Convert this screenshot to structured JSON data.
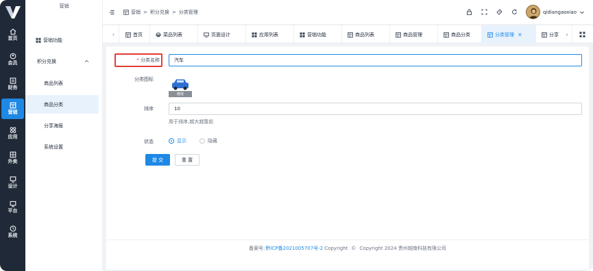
{
  "rail": {
    "items": [
      {
        "label": "首页"
      },
      {
        "label": "会员"
      },
      {
        "label": "财务"
      },
      {
        "label": "营销"
      },
      {
        "label": "应用"
      },
      {
        "label": "外卖"
      },
      {
        "label": "设计"
      },
      {
        "label": "平台"
      },
      {
        "label": "系统"
      }
    ]
  },
  "submenu": {
    "title": "营销",
    "items": [
      {
        "label": "营销功能"
      },
      {
        "label": "积分兑换"
      },
      {
        "label": "商品列表"
      },
      {
        "label": "商品分类"
      },
      {
        "label": "分享海报"
      },
      {
        "label": "系统设置"
      }
    ]
  },
  "breadcrumb": {
    "first": "营销",
    "sep1": ">",
    "second": "积分兑换",
    "sep2": ">",
    "third": "分类管理"
  },
  "user": {
    "name": "qidiangaoxiao"
  },
  "tabs": [
    {
      "label": "首页"
    },
    {
      "label": "菜品列表"
    },
    {
      "label": "页面设计"
    },
    {
      "label": "应用列表"
    },
    {
      "label": "营销功能"
    },
    {
      "label": "商品列表"
    },
    {
      "label": "商品管理"
    },
    {
      "label": "商品分类"
    },
    {
      "label": "分类管理"
    },
    {
      "label": "分享"
    }
  ],
  "tab_close": "×",
  "form": {
    "name_label_star": "*",
    "name_label": "分类名称",
    "name_value": "汽车",
    "icon_label": "分类图标",
    "icon_caption": "修改",
    "sort_label": "排序",
    "sort_value": "10",
    "sort_hint": "用于排序,越大越靠前",
    "status_label": "状态",
    "status_on": "显示",
    "status_off": "隐藏",
    "submit": "提 交",
    "reset": "重 置"
  },
  "footer": {
    "prefix": "备案号:",
    "icp": "黔ICP备2021005707号-2",
    "copy1": "Copyright",
    "copy_symbol": "©",
    "copy2": "Copyright 2024 贵州越南科技有限公司"
  },
  "colors": {
    "accent": "#1e88e5",
    "rail": "#1f2937",
    "highlight": "#e53935"
  }
}
